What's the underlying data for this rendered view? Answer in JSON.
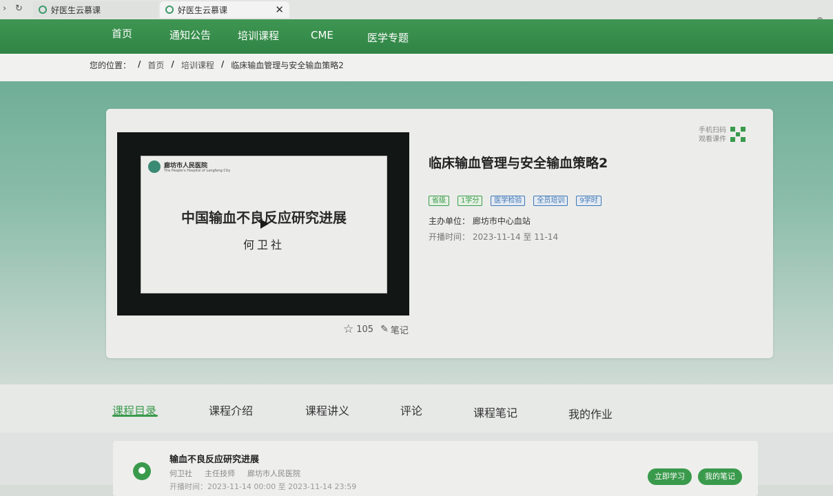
{
  "browser": {
    "tabs": [
      {
        "label": "好医生云慕课"
      },
      {
        "label": "好医生云慕课",
        "close": "✕"
      }
    ]
  },
  "nav": {
    "items": [
      "首页",
      "通知公告",
      "培训课程",
      "CME",
      "医学专题"
    ]
  },
  "breadcrumb": {
    "prefix": "您的位置：",
    "items": [
      "首页",
      "培训课程",
      "临床输血管理与安全输血策略2"
    ]
  },
  "video": {
    "slide_logo": "廊坊市人民医院",
    "slide_logo_sub": "The People's Hospital of Langfang City",
    "slide_title": "中国输血不良反应研究进展",
    "slide_author": "何卫社",
    "favorites": "105",
    "note_label": "笔记"
  },
  "course": {
    "title": "临床输血管理与安全输血策略2",
    "tags": [
      {
        "label": "省级",
        "color": "#3a9a4c"
      },
      {
        "label": "1学分",
        "color": "#3a9a4c"
      },
      {
        "label": "医学检验",
        "color": "#3f76b3"
      },
      {
        "label": "全员培训",
        "color": "#3f76b3"
      },
      {
        "label": "9学时",
        "color": "#3f76b3"
      }
    ],
    "organizer_label": "主办单位：",
    "organizer": "廊坊市中心血站",
    "time_label": "开播时间：",
    "time": "2023-11-14 至 11-14",
    "qr_line1": "手机扫码",
    "qr_line2": "观看课件"
  },
  "content_tabs": [
    "课程目录",
    "课程介绍",
    "课程讲义",
    "评论",
    "课程笔记",
    "我的作业"
  ],
  "lesson": {
    "title": "输血不良反应研究进展",
    "lecturer": "何卫社",
    "position": "主任技师",
    "hospital": "廊坊市人民医院",
    "time": "开播时间：2023-11-14 00:00 至 2023-11-14 23:59",
    "study_button": "立即学习",
    "notes_button": "我的笔记"
  },
  "colors": {
    "brand_green": "#3a9a4c",
    "tag_blue": "#3f76b3"
  }
}
